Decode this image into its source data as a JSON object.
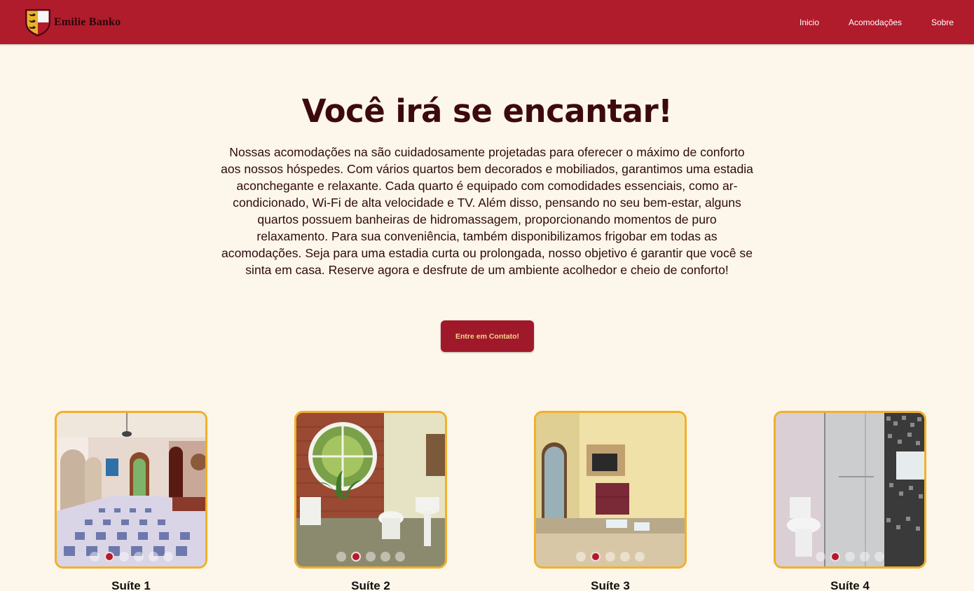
{
  "header": {
    "brand": "Emilie Banko",
    "nav": [
      "Inicio",
      "Acomodações",
      "Sobre"
    ]
  },
  "hero": {
    "title": "Você irá se encantar!",
    "text": "Nossas acomodações na são cuidadosamente projetadas para oferecer o máximo de conforto aos nossos hóspedes. Com vários quartos bem decorados e mobiliados, garantimos uma estadia aconchegante e relaxante. Cada quarto é equipado com comodidades essenciais, como ar-condicionado, Wi-Fi de alta velocidade e TV. Além disso, pensando no seu bem-estar, alguns quartos possuem banheiras de hidromassagem, proporcionando momentos de puro relaxamento. Para sua conveniência, também disponibilizamos frigobar em todas as acomodações. Seja para uma estadia curta ou prolongada, nosso objetivo é garantir que você se sinta em casa. Reserve agora e desfrute de um ambiente acolhedor e cheio de conforto!",
    "cta": "Entre em Contato!"
  },
  "suites": [
    {
      "label": "Suíte 1",
      "photo": "hallway",
      "slide_count": 6,
      "active_slide": 2
    },
    {
      "label": "Suíte 2",
      "photo": "bathroom-round-window",
      "slide_count": 5,
      "active_slide": 2
    },
    {
      "label": "Suíte 3",
      "photo": "bedroom-tv",
      "slide_count": 5,
      "active_slide": 2
    },
    {
      "label": "Suíte 4",
      "photo": "bathroom-shower",
      "slide_count": 5,
      "active_slide": 2
    }
  ],
  "colors": {
    "header": "#b01c2c",
    "background": "#fdf6ea",
    "accent_border": "#f2b02a",
    "cta_text": "#f7d58a"
  }
}
